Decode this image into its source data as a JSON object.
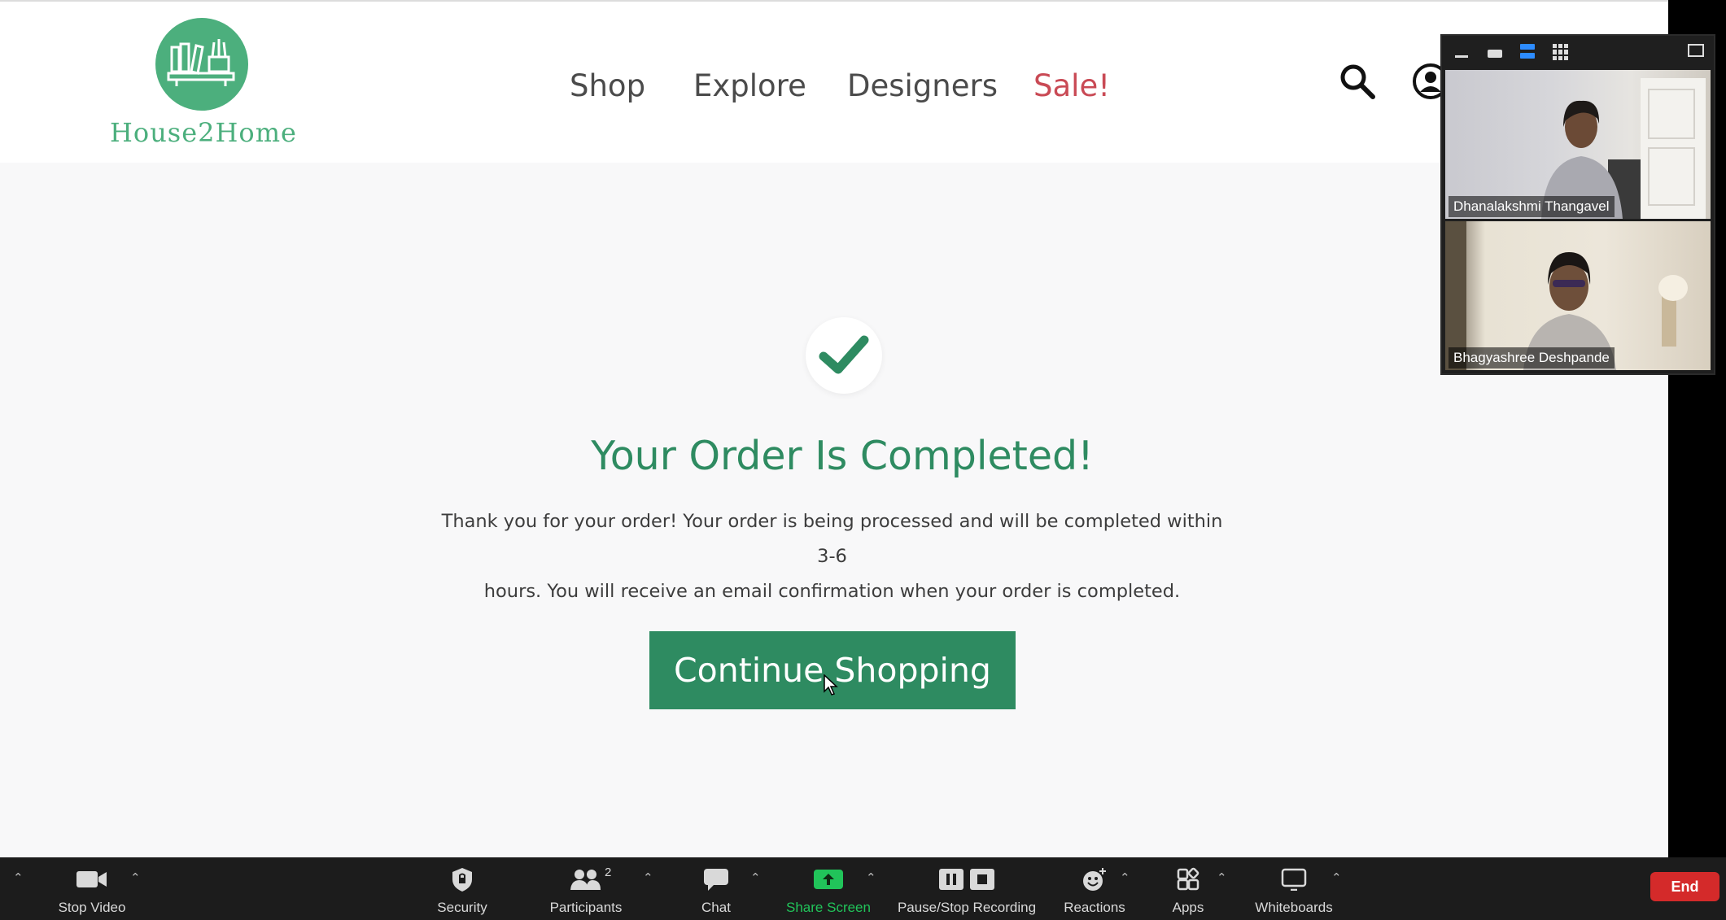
{
  "site": {
    "brand": "House2Home",
    "nav": [
      "Shop",
      "Explore",
      "Designers",
      "Sale!"
    ],
    "accent": "#2e8b61",
    "logo_color": "#4caf7d",
    "sale_color": "#c94a55"
  },
  "confirmation": {
    "title": "Your Order Is Completed!",
    "line1": "Thank you for your order! Your order is being processed and will be completed within 3-6",
    "line2": "hours. You will receive an email confirmation when your order is completed.",
    "button": "Continue Shopping"
  },
  "video_panel": {
    "participants": [
      {
        "name": "Dhanalakshmi Thangavel"
      },
      {
        "name": "Bhagyashree Deshpande"
      }
    ]
  },
  "toolbar": {
    "stop_video": "Stop Video",
    "security": "Security",
    "participants": "Participants",
    "participants_count": "2",
    "chat": "Chat",
    "share_screen": "Share Screen",
    "recording": "Pause/Stop Recording",
    "reactions": "Reactions",
    "apps": "Apps",
    "whiteboards": "Whiteboards",
    "end": "End"
  }
}
